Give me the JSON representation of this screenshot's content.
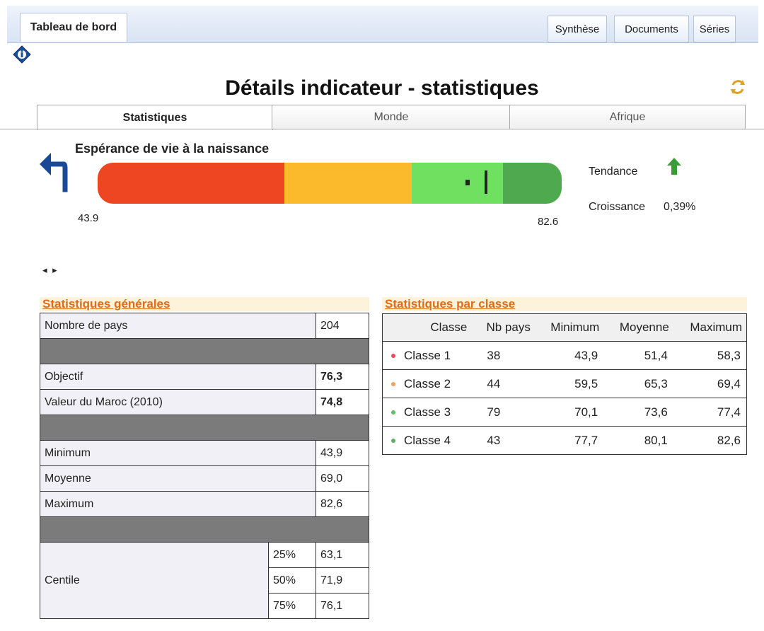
{
  "nav": {
    "main_tab": "Tableau de bord",
    "right_tabs": [
      "Synthèse",
      "Documents",
      "Séries"
    ]
  },
  "page_title": "Détails indicateur - statistiques",
  "subtabs": [
    "Statistiques",
    "Monde",
    "Afrique"
  ],
  "indicator": {
    "label": "Espérance de vie à la naissance",
    "min_label": "43.9",
    "max_label": "82.6",
    "gauge_min": 43.9,
    "gauge_max": 82.6,
    "segment_breaks": [
      59.5,
      70.1,
      77.7
    ],
    "segment_colors": [
      "#ee4522",
      "#fbb92c",
      "#6fe060",
      "#4ea94f"
    ],
    "current_value": 74.8,
    "target_value": 76.3
  },
  "trend": {
    "label": "Tendance",
    "icon": "up-arrow-icon",
    "color": "#3a9b3a"
  },
  "growth": {
    "label": "Croissance",
    "value": "0,39%"
  },
  "general_stats": {
    "title": "Statistiques générales",
    "count_label": "Nombre de pays",
    "count": "204",
    "objective_label": "Objectif",
    "objective": "76,3",
    "morocco_label": "Valeur du Maroc (2010)",
    "morocco": "74,8",
    "min_label": "Minimum",
    "min": "43,9",
    "mean_label": "Moyenne",
    "mean": "69,0",
    "max_label": "Maximum",
    "max": "82,6",
    "centile_label": "Centile",
    "centiles": [
      {
        "pct": "25%",
        "value": "63,1"
      },
      {
        "pct": "50%",
        "value": "71,9"
      },
      {
        "pct": "75%",
        "value": "76,1"
      }
    ]
  },
  "class_stats": {
    "title": "Statistiques par classe",
    "headers": [
      "Classe",
      "Nb pays",
      "Minimum",
      "Moyenne",
      "Maximum"
    ],
    "rows": [
      {
        "name": "Classe 1",
        "color": "#ee4a57",
        "count": "38",
        "min": "43,9",
        "mean": "51,4",
        "max": "58,3"
      },
      {
        "name": "Classe 2",
        "color": "#f4a060",
        "count": "44",
        "min": "59,5",
        "mean": "65,3",
        "max": "69,4"
      },
      {
        "name": "Classe 3",
        "color": "#5cc05c",
        "count": "79",
        "min": "70,1",
        "mean": "73,6",
        "max": "77,4"
      },
      {
        "name": "Classe 4",
        "color": "#5cb05c",
        "count": "43",
        "min": "77,7",
        "mean": "80,1",
        "max": "82,6"
      }
    ]
  }
}
